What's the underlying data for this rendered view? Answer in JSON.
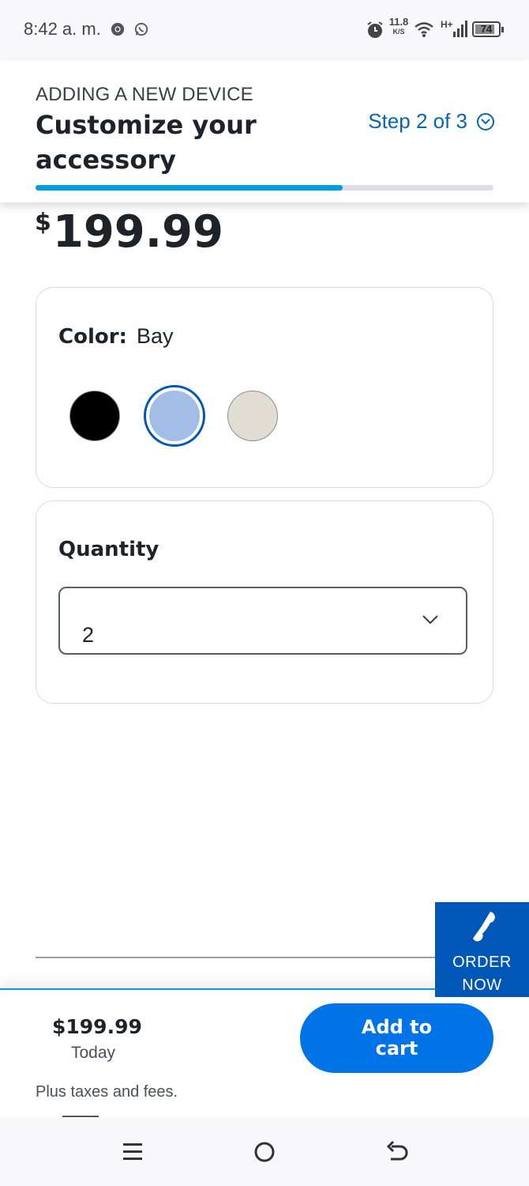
{
  "status_bar": {
    "time": "8:42 a. m.",
    "app_icons": [
      "chrome-icon",
      "whatsapp-icon"
    ],
    "net_speed_value": "11.8",
    "net_speed_unit": "K/S",
    "network_type": "H+",
    "battery": "74"
  },
  "header": {
    "kicker": "ADDING A NEW DEVICE",
    "title": "Customize your accessory",
    "step_label": "Step 2 of 3",
    "progress_fraction": 0.67
  },
  "product": {
    "price_currency": "$",
    "price_value": "199.99"
  },
  "color_option": {
    "label": "Color:",
    "selected_name": "Bay",
    "swatches": [
      {
        "name": "Black",
        "hex": "#000000",
        "selected": false
      },
      {
        "name": "Bay",
        "hex": "#a3bde6",
        "selected": true
      },
      {
        "name": "Light beige",
        "hex": "#e2ddd2",
        "selected": false
      }
    ]
  },
  "quantity": {
    "label": "Quantity",
    "selected": "2"
  },
  "order_now": {
    "label_line1": "ORDER",
    "label_line2": "NOW"
  },
  "footer": {
    "price": "$199.99",
    "price_caption": "Today",
    "note": "Plus taxes and fees.",
    "add_to_cart": "Add to cart"
  },
  "colors": {
    "accent_blue": "#0057b8",
    "link_blue": "#0568ae",
    "button_blue": "#0073e6",
    "progress_blue": "#009fdb"
  }
}
